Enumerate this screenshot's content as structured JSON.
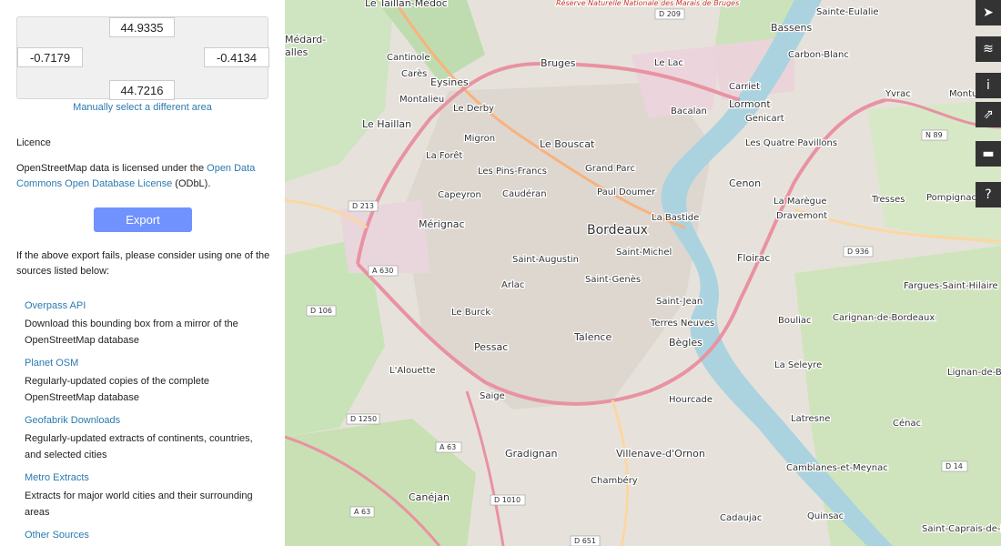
{
  "export": {
    "bbox": {
      "north": "44.9335",
      "west": "-0.7179",
      "east": "-0.4134",
      "south": "44.7216"
    },
    "manual_link": "Manually select a different area",
    "licence_heading": "Licence",
    "licence_text_1": "OpenStreetMap data is licensed under the ",
    "licence_link": "Open Data Commons Open Database License",
    "licence_text_2": " (ODbL).",
    "export_button": "Export",
    "fail_text": "If the above export fails, please consider using one of the sources listed below:",
    "sources": [
      {
        "title": "Overpass API",
        "desc": "Download this bounding box from a mirror of the OpenStreetMap database"
      },
      {
        "title": "Planet OSM",
        "desc": "Regularly-updated copies of the complete OpenStreetMap database"
      },
      {
        "title": "Geofabrik Downloads",
        "desc": "Regularly-updated extracts of continents, countries, and selected cities"
      },
      {
        "title": "Metro Extracts",
        "desc": "Extracts for major world cities and their surrounding areas"
      },
      {
        "title": "Other Sources",
        "desc": ""
      }
    ]
  },
  "map": {
    "labels": {
      "bordeaux": "Bordeaux",
      "bouscat": "Le Bouscat",
      "bruges": "Bruges",
      "eysines": "Eysines",
      "merignac": "Mérignac",
      "pessac": "Pessac",
      "talence": "Talence",
      "begles": "Bègles",
      "floirac": "Floirac",
      "cenon": "Cenon",
      "lormont": "Lormont",
      "bassens": "Bassens",
      "carbon_blanc": "Carbon-Blanc",
      "haillan": "Le Haillan",
      "gradignan": "Gradignan",
      "villenave": "Villenave-d'Ornon",
      "canejan": "Canéjan",
      "bouliac": "Bouliac",
      "carignan": "Carignan-de-Bordeaux",
      "tresses": "Tresses",
      "pompignac": "Pompignac",
      "fargues": "Fargues-Saint-Hilaire",
      "lignan": "Lignan-de-Bordeaux",
      "cenac": "Cénac",
      "latresne": "Latresne",
      "camblanes": "Camblanes-et-Meynac",
      "quinsac": "Quinsac",
      "cadaujac": "Cadaujac",
      "saint_caprais": "Saint-Caprais-de-Bordeaux",
      "yvrac": "Yvrac",
      "montussan": "Montussan",
      "sainte_eulalie": "Sainte-Eulalie",
      "taillan": "Le Taillan-Médoc",
      "medard": "Médard-",
      "alles": "alles",
      "cantinole": "Cantinole",
      "cares": "Carès",
      "montalieu": "Montalieu",
      "derby": "Le Derby",
      "migron": "Migron",
      "laforet": "La Forêt",
      "pins_francs": "Les Pins-Francs",
      "grand_parc": "Grand Parc",
      "paul_doumer": "Paul Doumer",
      "caudéran": "Caudéran",
      "capeyron": "Capeyron",
      "bastide": "La Bastide",
      "saint_michel": "Saint-Michel",
      "saint_augustin": "Saint-Augustin",
      "arlac": "Arlac",
      "saint_genes": "Saint-Genès",
      "saint_jean": "Saint-Jean",
      "terres_neuves": "Terres Neuves",
      "le_burck": "Le Burck",
      "alouette": "L'Alouette",
      "saige": "Saige",
      "hourcade": "Hourcade",
      "chambery": "Chambéry",
      "le_lac": "Le Lac",
      "bacalan": "Bacalan",
      "genicart": "Genicart",
      "carriet": "Carriet",
      "quatre_pavillons": "Les Quatre Pavillons",
      "maregue": "La Marègue",
      "dravemont": "Dravemont",
      "seleyre": "La Seleyre",
      "reserve": "Réserve Naturelle Nationale des Marais de Bruges"
    },
    "roads": [
      "D 209",
      "D 213",
      "A 630",
      "D 106",
      "D 1250",
      "A 63",
      "D 1010",
      "D 651",
      "D 936",
      "N 89",
      "D 14",
      "A 63"
    ]
  },
  "controls": [
    {
      "icon": "locate-icon",
      "glyph": "➤"
    },
    {
      "icon": "layers-icon",
      "glyph": "≋"
    },
    {
      "icon": "info-icon",
      "glyph": "i"
    },
    {
      "icon": "share-icon",
      "glyph": "⇗"
    },
    {
      "icon": "note-icon",
      "glyph": "▬"
    },
    {
      "icon": "help-icon",
      "glyph": "?"
    }
  ]
}
